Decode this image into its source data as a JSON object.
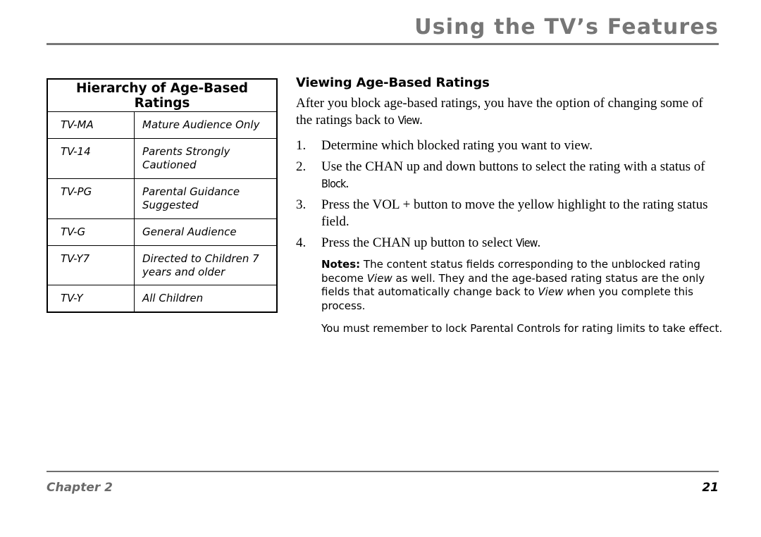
{
  "header": {
    "title": "Using the TV’s Features",
    "rule_color": "#777777"
  },
  "table": {
    "title": "Hierarchy of Age-Based Ratings",
    "rows": [
      {
        "code": "TV-MA",
        "description": "Mature Audience Only"
      },
      {
        "code": "TV-14",
        "description": "Parents Strongly Cautioned"
      },
      {
        "code": "TV-PG",
        "description": "Parental Guidance Suggested"
      },
      {
        "code": "TV-G",
        "description": "General Audience"
      },
      {
        "code": "TV-Y7",
        "description": "Directed to Children 7 years and older"
      },
      {
        "code": "TV-Y",
        "description": "All Children"
      }
    ]
  },
  "section": {
    "heading": "Viewing Age-Based Ratings",
    "intro_before": "After you block age-based ratings, you have the option of changing some of the ratings back to ",
    "intro_ui_word": "View",
    "intro_after": ".",
    "steps": [
      {
        "number": "1.",
        "text_before": "Determine which blocked rating you want to view.",
        "ui_word": "",
        "text_after": ""
      },
      {
        "number": "2.",
        "text_before": "Use the CHAN up and down buttons to select the rating with a status of ",
        "ui_word": "Block",
        "text_after": "."
      },
      {
        "number": "3.",
        "text_before": "Press the VOL + button to move the yellow highlight to the rating status field.",
        "ui_word": "",
        "text_after": ""
      },
      {
        "number": "4.",
        "text_before": "Press the CHAN up button to select ",
        "ui_word": "View",
        "text_after": "."
      }
    ],
    "notes": {
      "label": "Notes:",
      "part1": " The content status fields corresponding to the unblocked rating become ",
      "italic1": "View",
      "part2": " as well. They and the age-based rating status are the only fields that automatically change back to ",
      "italic2": "View w",
      "part3": "hen you complete this process."
    },
    "closing_note": "You must remember to lock Parental Controls for rating limits to take effect."
  },
  "footer": {
    "chapter": "Chapter 2",
    "page_number": "21",
    "chapter_color": "#6a6a6a"
  }
}
